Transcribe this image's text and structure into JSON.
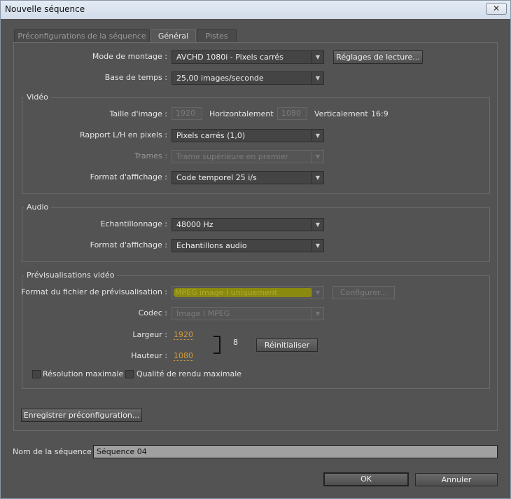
{
  "window": {
    "title": "Nouvelle séquence",
    "close": "✕"
  },
  "tabs": [
    "Préconfigurations de la séquence",
    "Général",
    "Pistes"
  ],
  "general": {
    "mode_label": "Mode de montage :",
    "mode_value": "AVCHD 1080i - Pixels carrés",
    "playback_button": "Réglages de lecture...",
    "timebase_label": "Base de temps :",
    "timebase_value": "25,00 images/seconde"
  },
  "video": {
    "legend": "Vidéo",
    "frame_size_label": "Taille d'image :",
    "width": "1920",
    "horizontal": "Horizontalement",
    "height": "1080",
    "vertical": "Verticalement",
    "ratio": "16:9",
    "par_label": "Rapport L/H en pixels :",
    "par_value": "Pixels carrés (1,0)",
    "fields_label": "Trames :",
    "fields_value": "Trame supérieure en premier",
    "display_label": "Format d'affichage :",
    "display_value": "Code temporel 25 i/s"
  },
  "audio": {
    "legend": "Audio",
    "rate_label": "Echantillonnage :",
    "rate_value": "48000 Hz",
    "display_label": "Format d'affichage :",
    "display_value": "Echantillons audio"
  },
  "preview": {
    "legend": "Prévisualisations vidéo",
    "format_label": "Format du fichier de prévisualisation :",
    "format_value": "MPEG image I uniquement",
    "configure_button": "Configurer...",
    "codec_label": "Codec :",
    "codec_value": "Image I MPEG",
    "width_label": "Largeur :",
    "width_value": "1920",
    "height_label": "Hauteur :",
    "height_value": "1080",
    "reset_button": "Réinitialiser",
    "max_res": "Résolution maximale",
    "max_quality": "Qualité de rendu maximale",
    "highlight_color": "#8a8a10"
  },
  "save_preset_button": "Enregistrer préconfiguration...",
  "sequence_name_label": "Nom de la séquence :",
  "sequence_name_value": "Séquence 04",
  "ok_button": "OK",
  "cancel_button": "Annuler"
}
